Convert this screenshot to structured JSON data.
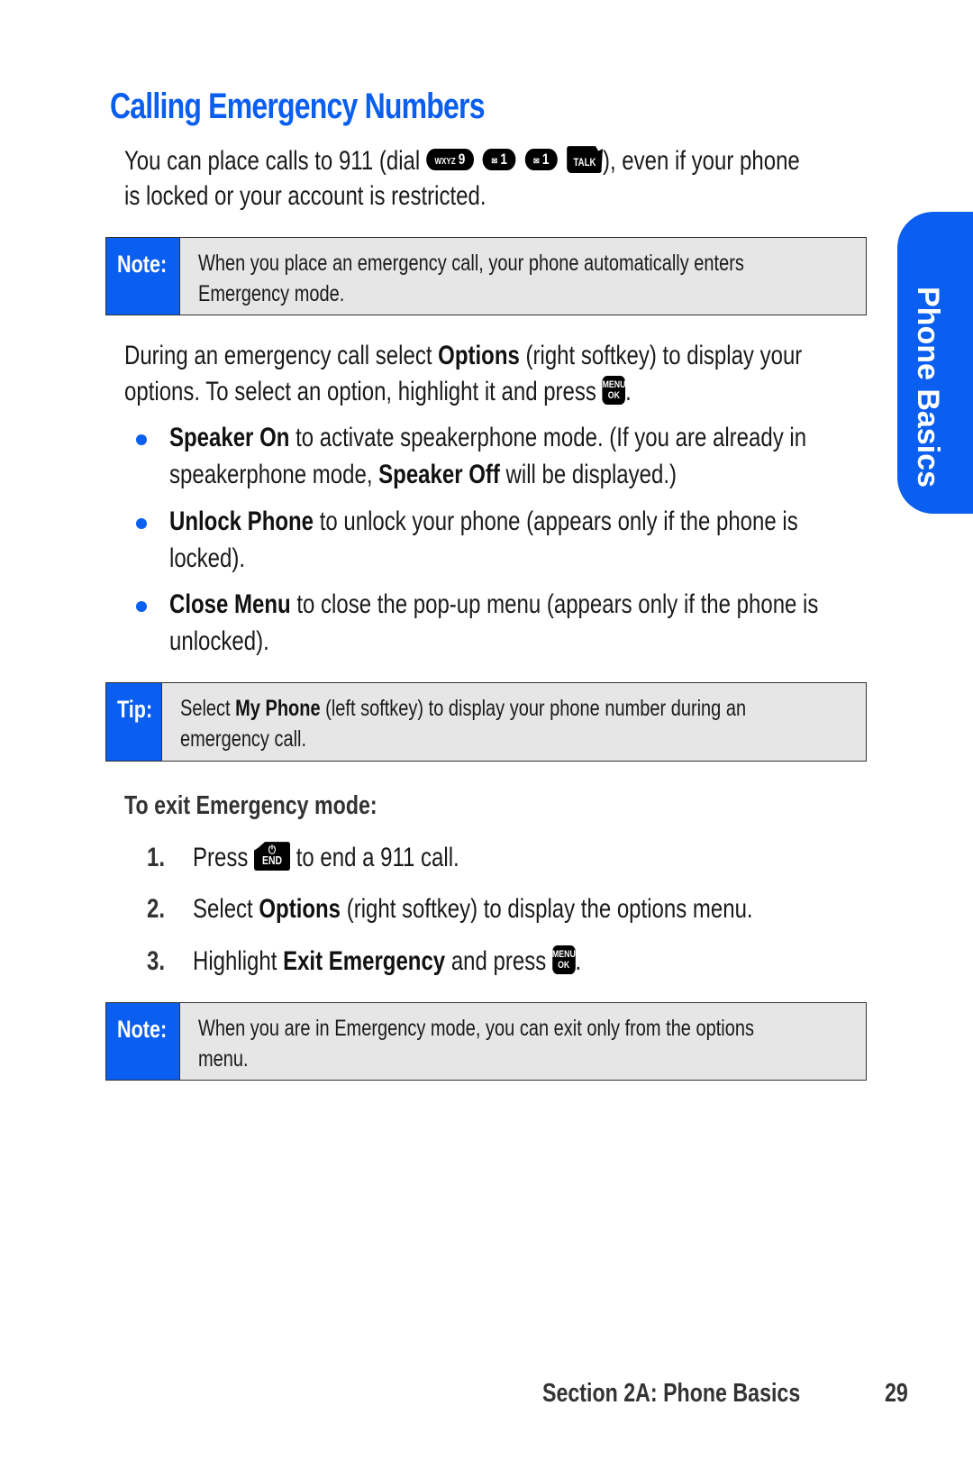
{
  "title": "Calling Emergency Numbers",
  "intro": {
    "line1_before": "You can place calls to 911 (dial ",
    "keys": [
      {
        "small": "WXYZ",
        "main": "9"
      },
      {
        "small": "✉",
        "main": "1"
      },
      {
        "small": "✉",
        "main": "1"
      }
    ],
    "talk_key": "TALK",
    "line1_after": "), even if your phone",
    "line2": "is locked or your account is restricted."
  },
  "note1": {
    "label": "Note:",
    "line1": "When you place an emergency call, your phone automatically enters",
    "line2": "Emergency mode."
  },
  "options_para": {
    "l1_a": "During an emergency call select ",
    "l1_b": "Options",
    "l1_c": " (right softkey) to display your",
    "l2": "options. To select an option, highlight it and press ",
    "menu_key": {
      "top": "MENU",
      "bottom": "OK"
    },
    "l2_end": "."
  },
  "bullets": [
    {
      "bold": "Speaker On",
      "text1": " to activate speakerphone mode. (If you are already in",
      "line2_a": "speakerphone mode, ",
      "line2_bold": "Speaker Off",
      "line2_b": " will be displayed.)"
    },
    {
      "bold": "Unlock Phone",
      "text1": " to unlock your phone (appears only if the phone is",
      "line2": "locked)."
    },
    {
      "bold": "Close Menu",
      "text1": " to close the pop-up menu (appears only if the phone is",
      "line2": "unlocked)."
    }
  ],
  "tip": {
    "label": "Tip:",
    "l1_a": "Select ",
    "l1_bold": "My Phone",
    "l1_b": " (left softkey) to display your phone number during an",
    "line2": "emergency call."
  },
  "exit_heading": "To exit Emergency mode:",
  "steps": [
    {
      "num": "1.",
      "a": "Press ",
      "key": "END",
      "b": " to end a 911 call."
    },
    {
      "num": "2.",
      "a": "Select ",
      "bold": "Options",
      "b": " (right softkey) to display the options menu."
    },
    {
      "num": "3.",
      "a": "Highlight ",
      "bold": "Exit Emergency",
      "b": " and press ",
      "end": "."
    }
  ],
  "note2": {
    "label": "Note:",
    "line1": "When you are in Emergency mode, you can exit only from the options",
    "line2": "menu."
  },
  "side_tab": "Phone Basics",
  "footer": {
    "section": "Section 2A: Phone Basics",
    "page": "29"
  },
  "colors": {
    "accent": "#0a5ef0",
    "box_bg": "#e6e6e6"
  }
}
